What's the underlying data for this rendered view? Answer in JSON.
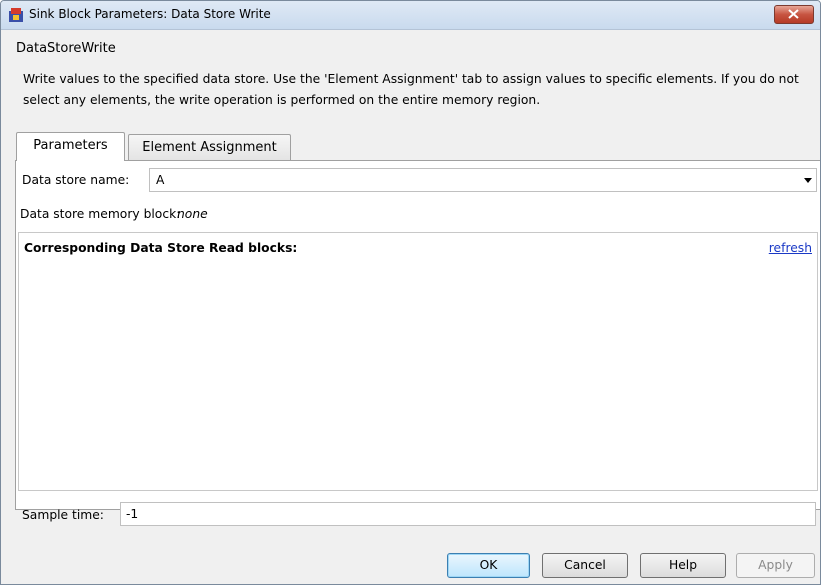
{
  "window": {
    "title": "Sink Block Parameters: Data Store Write",
    "close_label": "×"
  },
  "block": {
    "name": "DataStoreWrite",
    "description": "Write values to the specified data store. Use the 'Element Assignment' tab to assign values to specific elements. If you do not select any elements, the write operation is performed on the entire memory region."
  },
  "tabs": [
    {
      "label": "Parameters",
      "selected": true
    },
    {
      "label": "Element Assignment",
      "selected": false
    }
  ],
  "parameters": {
    "data_store_name_label": "Data store name:",
    "data_store_name_value": "A",
    "memory_block_label": "Data store memory block:",
    "memory_block_value": "none",
    "read_blocks_title": "Corresponding Data Store Read blocks:",
    "refresh_link": "refresh",
    "sample_time_label": "Sample time:",
    "sample_time_value": "-1"
  },
  "buttons": {
    "ok": "OK",
    "cancel": "Cancel",
    "help": "Help",
    "apply": "Apply"
  },
  "icons": {
    "app": "simulink-block-icon",
    "close": "close-icon",
    "dropdown": "chevron-down-icon"
  },
  "colors": {
    "link": "#1a39c6",
    "close_button": "#c75441",
    "disabled_text": "#8a8a8a"
  }
}
